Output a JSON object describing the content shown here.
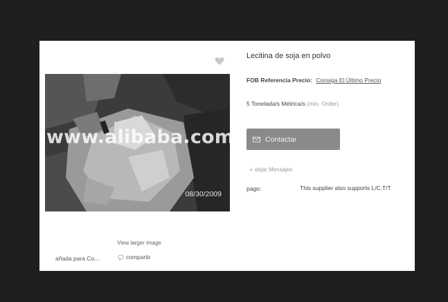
{
  "product": {
    "title": "Lecitina de soja en polvo",
    "price_label": "FOB Referencia Precio:",
    "price_link": "Consiga El Último Precio",
    "moq_value": "5 Tonelada/s Métrica/s",
    "moq_note": "(min. Order)",
    "contact_button": "Contactar",
    "leave_message": "dejar Mensajes",
    "payment_label": "pago:",
    "payment_value": "This supplier also supports L/C,T/T"
  },
  "image": {
    "watermark": "www.alibaba.com",
    "date_stamp": "08/30/2009",
    "view_larger": "View larger image"
  },
  "actions": {
    "add_to_compare": "añada para Co...",
    "share": "compartir"
  },
  "icons": {
    "favorite": "heart-icon",
    "contact": "mail-icon",
    "share": "share-icon"
  },
  "colors": {
    "background": "#1f1f1f",
    "card": "#ffffff",
    "button": "#8a8a8a"
  }
}
